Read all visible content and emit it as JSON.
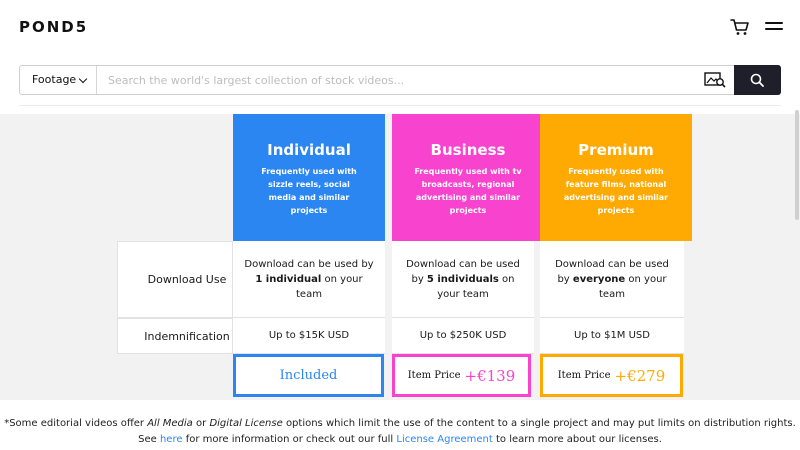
{
  "header": {
    "logo": "POND5"
  },
  "search": {
    "category": "Footage",
    "placeholder": "Search the world's largest collection of stock videos..."
  },
  "plans": [
    {
      "name": "Individual",
      "desc": "Frequently used with sizzle reels, social media and similar projects",
      "color": "#2b86f2",
      "download_pre": "Download can be used by",
      "download_bold": "1 individual",
      "download_post": "on your team",
      "indemnification": "Up to $15K USD",
      "price_text": "Included"
    },
    {
      "name": "Business",
      "desc": "Frequently used with tv broadcasts, regional advertising and similar projects",
      "color": "#f843cf",
      "download_pre": "Download can be used by",
      "download_bold": "5 individuals",
      "download_post": "on your team",
      "indemnification": "Up to $250K USD",
      "price_label": "Item Price",
      "price_value": "+€139"
    },
    {
      "name": "Premium",
      "desc": "Frequently used with feature films, national advertising and similar projects",
      "color": "#feaa03",
      "download_pre": "Download can be used by",
      "download_bold": "everyone",
      "download_post": "on your team",
      "indemnification": "Up to $1M USD",
      "price_label": "Item Price",
      "price_value": "+€279"
    }
  ],
  "rows": {
    "download_use": "Download Use",
    "indemnification": "Indemnification"
  },
  "footnote": {
    "line1_a": "*Some editorial videos offer",
    "line1_media": "All Media",
    "line1_or": "or",
    "line1_digital": "Digital License",
    "line1_b": "options which limit the use of the content to a single project and may put limits on distribution rights.",
    "line2_see": "See",
    "line2_here": "here",
    "line2_mid": "for more information or check out our full",
    "line2_license": "License Agreement",
    "line2_end": "to learn more about our licenses."
  },
  "icons": {
    "cart": "cart-icon",
    "menu": "menu-icon",
    "visual_search": "visual-search-icon",
    "search": "search-icon"
  }
}
